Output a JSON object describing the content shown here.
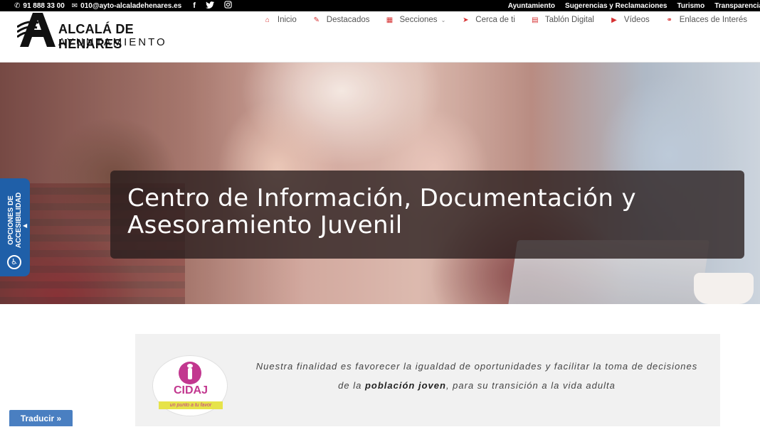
{
  "topbar": {
    "phone": "91 888 33 00",
    "email": "010@ayto-alcaladehenares.es",
    "social": [
      {
        "icon": "facebook-icon",
        "glyph": "f"
      },
      {
        "icon": "twitter-icon",
        "glyph": "🐦"
      },
      {
        "icon": "instagram-icon",
        "glyph": "◎"
      }
    ],
    "links": [
      "Ayuntamiento",
      "Sugerencias y Reclamaciones",
      "Turismo",
      "Transparencia"
    ]
  },
  "logo": {
    "line1": "ALCALÁ DE HENARES",
    "line2": "AYUNTAMIENTO"
  },
  "nav": [
    {
      "label": "Inicio",
      "icon": "home-icon",
      "glyph": "⌂"
    },
    {
      "label": "Destacados",
      "icon": "pin-icon",
      "glyph": "✎"
    },
    {
      "label": "Secciones",
      "icon": "grid-icon",
      "glyph": "▦",
      "dropdown": true
    },
    {
      "label": "Cerca de ti",
      "icon": "location-icon",
      "glyph": "➤"
    },
    {
      "label": "Tablón Digital",
      "icon": "board-icon",
      "glyph": "▤"
    },
    {
      "label": "Vídeos",
      "icon": "video-icon",
      "glyph": "▶"
    },
    {
      "label": "Enlaces de Interés",
      "icon": "link-icon",
      "glyph": "⚭"
    }
  ],
  "hero": {
    "title": "Centro de Información, Documentación y Asesoramiento Juvenil"
  },
  "accessibility": {
    "label": "OPCIONES DE ACCESIBILIDAD"
  },
  "panel": {
    "logo_word": "CIDAJ",
    "logo_tagline": "un punto a tu favor",
    "mission_before": "Nuestra finalidad es favorecer la igualdad de oportunidades y facilitar la toma de decisiones de la ",
    "mission_bold": "población joven",
    "mission_after": ", para su transición a la vida adulta"
  },
  "translate": {
    "label": "Traducir »"
  },
  "colors": {
    "accent": "#d63031",
    "a11y_blue": "#1f5fa8",
    "cidaj_pink": "#c2378f",
    "translate_blue": "#4a7fc1"
  }
}
